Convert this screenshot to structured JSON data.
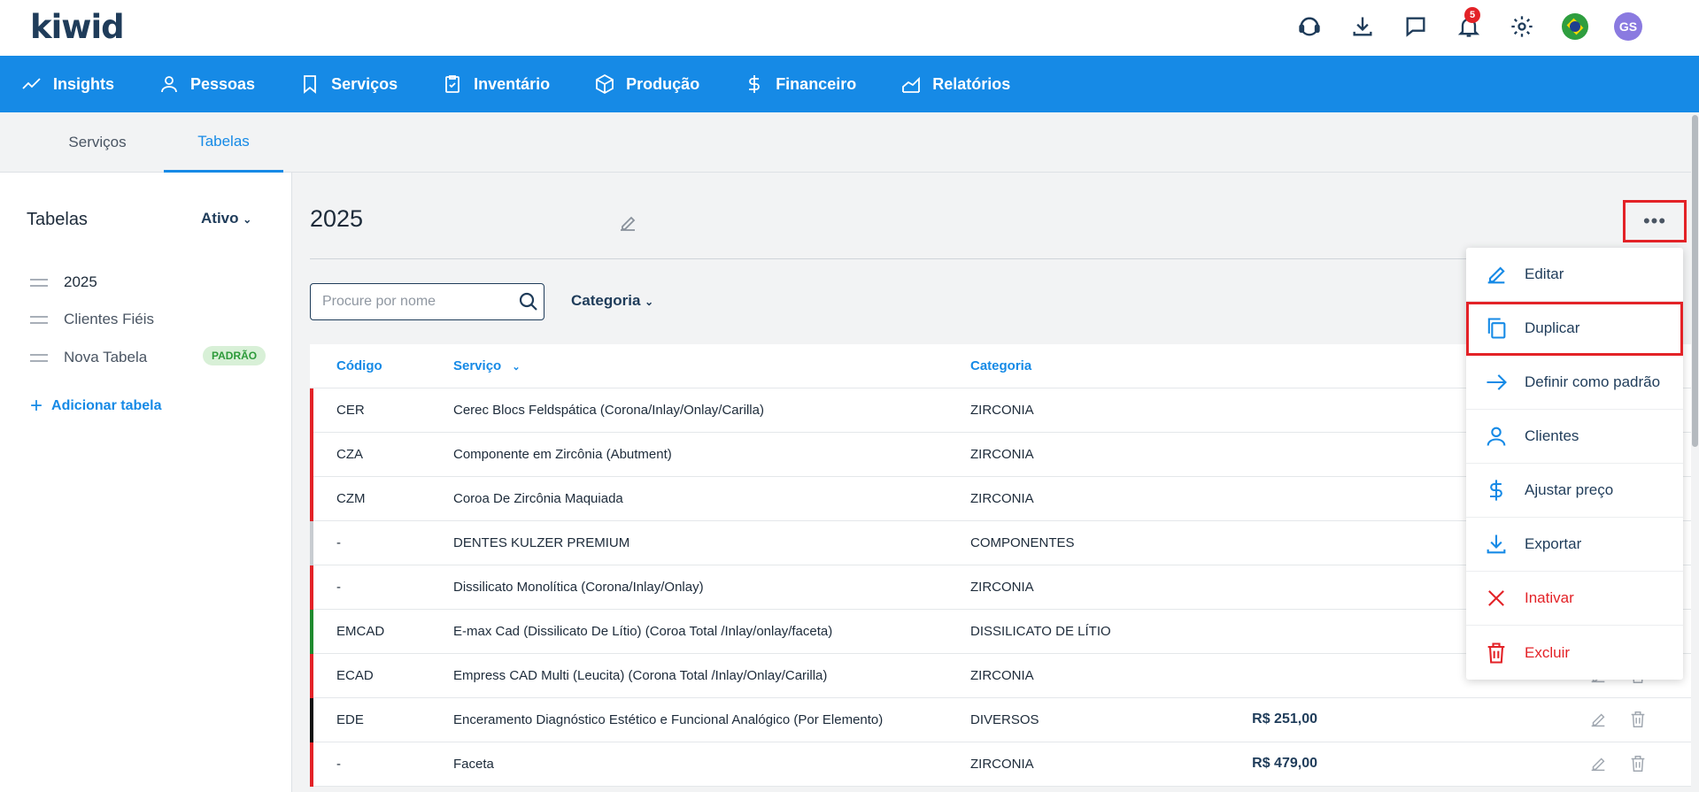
{
  "brand": {
    "name": "kiwid"
  },
  "header": {
    "notifications_count": "5",
    "avatar_initials": "GS"
  },
  "nav": [
    {
      "label": "Insights",
      "icon": "trend-line-icon"
    },
    {
      "label": "Pessoas",
      "icon": "person-icon"
    },
    {
      "label": "Serviços",
      "icon": "bookmark-icon"
    },
    {
      "label": "Inventário",
      "icon": "clipboard-icon"
    },
    {
      "label": "Produção",
      "icon": "box-icon"
    },
    {
      "label": "Financeiro",
      "icon": "dollar-icon"
    },
    {
      "label": "Relatórios",
      "icon": "area-chart-icon"
    }
  ],
  "subtabs": [
    {
      "label": "Serviços",
      "active": false
    },
    {
      "label": "Tabelas",
      "active": true
    }
  ],
  "sidebar": {
    "title": "Tabelas",
    "filter": "Ativo",
    "items": [
      {
        "label": "2025",
        "active": true
      },
      {
        "label": "Clientes Fiéis",
        "active": false
      },
      {
        "label": "Nova Tabela",
        "active": false,
        "tag": "PADRÃO"
      }
    ],
    "add_label": "Adicionar tabela"
  },
  "main": {
    "title": "2025",
    "search_placeholder": "Procure por nome",
    "category_filter": "Categoria"
  },
  "table": {
    "columns": {
      "code": "Código",
      "service": "Serviço",
      "category": "Categoria"
    },
    "rows": [
      {
        "code": "CER",
        "service": "Cerec Blocs Feldspática (Corona/Inlay/Onlay/Carilla)",
        "category": "ZIRCONIA",
        "price": "",
        "color": "#e32227"
      },
      {
        "code": "CZA",
        "service": "Componente em Zircônia (Abutment)",
        "category": "ZIRCONIA",
        "price": "",
        "color": "#e32227"
      },
      {
        "code": "CZM",
        "service": "Coroa De Zircônia Maquiada",
        "category": "ZIRCONIA",
        "price": "",
        "color": "#e32227"
      },
      {
        "code": "-",
        "service": "DENTES KULZER PREMIUM",
        "category": "COMPONENTES",
        "price": "",
        "color": "#c8ccd1"
      },
      {
        "code": "-",
        "service": "Dissilicato Monolítica (Corona/Inlay/Onlay)",
        "category": "ZIRCONIA",
        "price": "",
        "color": "#e32227"
      },
      {
        "code": "EMCAD",
        "service": "E-max Cad (Dissilicato De Lítio) (Coroa Total /Inlay/onlay/faceta)",
        "category": "DISSILICATO DE LÍTIO",
        "price": "",
        "color": "#1f8a2e"
      },
      {
        "code": "ECAD",
        "service": "Empress CAD Multi (Leucita) (Corona Total /Inlay/Onlay/Carilla)",
        "category": "ZIRCONIA",
        "price": "",
        "color": "#e32227"
      },
      {
        "code": "EDE",
        "service": "Enceramento Diagnóstico Estético e Funcional Analógico (Por Elemento)",
        "category": "DIVERSOS",
        "price": "R$ 251,00",
        "color": "#111111"
      },
      {
        "code": "-",
        "service": "Faceta",
        "category": "ZIRCONIA",
        "price": "R$ 479,00",
        "color": "#e32227"
      }
    ]
  },
  "menu": [
    {
      "label": "Editar",
      "icon": "pencil-icon",
      "danger": false,
      "highlight": false
    },
    {
      "label": "Duplicar",
      "icon": "copy-icon",
      "danger": false,
      "highlight": true
    },
    {
      "label": "Definir como padrão",
      "icon": "arrow-right-icon",
      "danger": false,
      "highlight": false
    },
    {
      "label": "Clientes",
      "icon": "person-icon",
      "danger": false,
      "highlight": false
    },
    {
      "label": "Ajustar preço",
      "icon": "dollar-icon",
      "danger": false,
      "highlight": false
    },
    {
      "label": "Exportar",
      "icon": "download-icon",
      "danger": false,
      "highlight": false
    },
    {
      "label": "Inativar",
      "icon": "x-icon",
      "danger": true,
      "highlight": false
    },
    {
      "label": "Excluir",
      "icon": "trash-icon",
      "danger": true,
      "highlight": false
    }
  ]
}
